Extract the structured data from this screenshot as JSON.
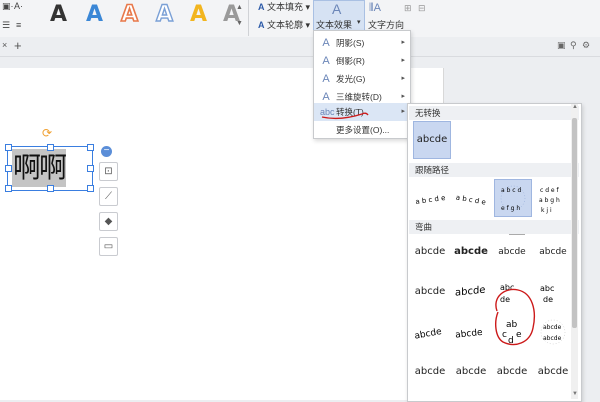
{
  "ribbon": {
    "text_fill_label": "文本填充",
    "text_outline_label": "文本轮廓",
    "text_effect_label": "文本效果",
    "text_direction_label": "文字方向",
    "style_glyph": "A",
    "style_colors": [
      "#111111",
      "#3b87d6",
      "#e8784a",
      "#8fb1dc",
      "#f2b51f",
      "#9a9a9a"
    ]
  },
  "text_box": {
    "content": "啊啊"
  },
  "effect_menu": {
    "items": [
      {
        "label": "阴影(S)",
        "icon": "shadow-icon",
        "has_submenu": true
      },
      {
        "label": "倒影(R)",
        "icon": "reflection-icon",
        "has_submenu": true
      },
      {
        "label": "发光(G)",
        "icon": "glow-icon",
        "has_submenu": true
      },
      {
        "label": "三维旋转(D)",
        "icon": "rotate-3d-icon",
        "has_submenu": true
      },
      {
        "label": "转换(T)",
        "icon": "transform-icon",
        "has_submenu": true,
        "active": true
      },
      {
        "label": "更多设置(O)...",
        "icon": "",
        "has_submenu": false
      }
    ]
  },
  "transform_gallery": {
    "section_no_transform": "无转换",
    "no_transform_sample": "abcde",
    "section_follow_path": "跟随路径",
    "section_warp": "弯曲",
    "warp_sample": "abcde",
    "tooltip_text": "圆"
  },
  "annotation": {
    "color": "#cc1a1a"
  }
}
